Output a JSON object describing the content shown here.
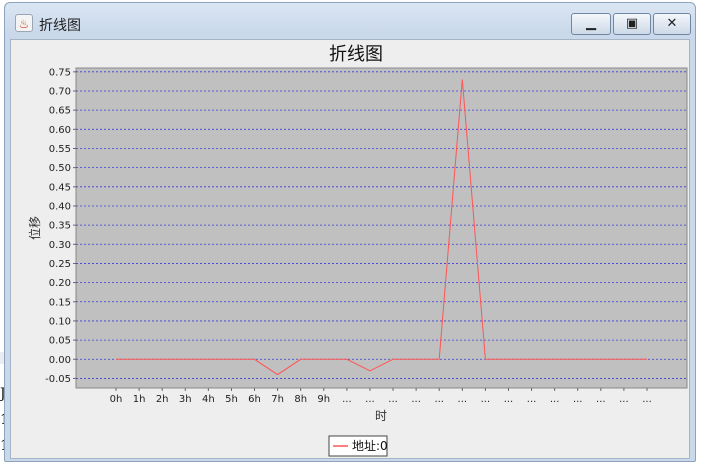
{
  "window": {
    "title": "折线图"
  },
  "background_fragments": [
    "J",
    "1",
    "1"
  ],
  "chart_data": {
    "type": "line",
    "title": "折线图",
    "xlabel": "时",
    "ylabel": "位移",
    "categories": [
      "0h",
      "1h",
      "2h",
      "3h",
      "4h",
      "5h",
      "6h",
      "7h",
      "8h",
      "9h",
      "...",
      "...",
      "...",
      "...",
      "...",
      "...",
      "...",
      "...",
      "...",
      "...",
      "...",
      "...",
      "...",
      "..."
    ],
    "series": [
      {
        "name": "地址:0",
        "values": [
          0,
          0,
          0,
          0,
          0,
          0,
          0,
          -0.04,
          0,
          0,
          0,
          -0.03,
          0,
          0,
          0,
          0.73,
          0,
          0,
          0,
          0,
          0,
          0,
          0,
          0
        ]
      }
    ],
    "ylim": [
      -0.075,
      0.76
    ],
    "yticks": [
      -0.05,
      0,
      0.05,
      0.1,
      0.15,
      0.2,
      0.25,
      0.3,
      0.35,
      0.4,
      0.45,
      0.5,
      0.55,
      0.6,
      0.65,
      0.7,
      0.75
    ],
    "grid": true,
    "legend_position": "bottom",
    "colors": {
      "series": "#ff5555",
      "plot_bg": "#c0c0c0",
      "grid": "#3b3bd9"
    }
  }
}
